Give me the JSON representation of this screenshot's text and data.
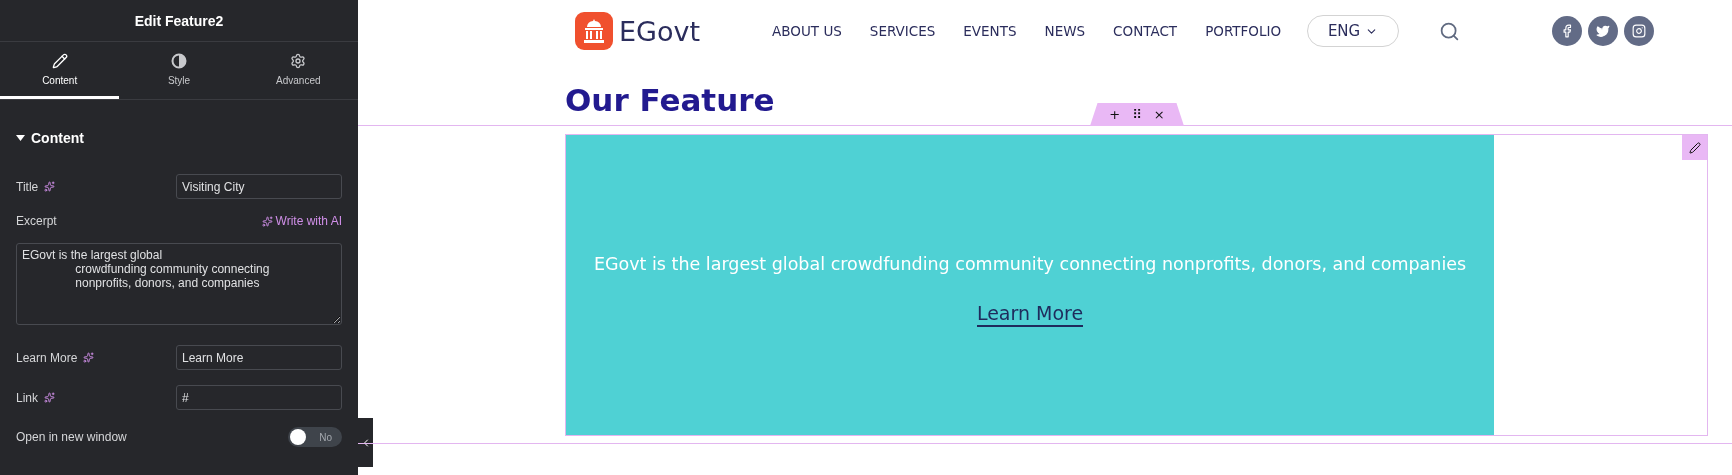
{
  "panel": {
    "title": "Edit Feature2",
    "tabs": [
      {
        "label": "Content",
        "selected": true
      },
      {
        "label": "Style",
        "selected": false
      },
      {
        "label": "Advanced",
        "selected": false
      }
    ],
    "section": {
      "title": "Content",
      "expanded": true
    },
    "fields": [
      {
        "kind": "input",
        "label": "Title",
        "ai": true,
        "value": "Visiting City"
      },
      {
        "kind": "textarea",
        "label": "Excerpt",
        "action": "Write with AI",
        "value": "EGovt is the largest global\n                crowdfunding community connecting\n                nonprofits, donors, and companies"
      },
      {
        "kind": "input",
        "label": "Learn More",
        "ai": true,
        "value": "Learn More"
      },
      {
        "kind": "input",
        "label": "Link",
        "ai": true,
        "value": "#"
      },
      {
        "kind": "toggle",
        "label": "Open in new window",
        "on": false,
        "state_label": "No"
      }
    ]
  },
  "site": {
    "logo": "EGovt",
    "nav": [
      "ABOUT US",
      "SERVICES",
      "EVENTS",
      "NEWS",
      "CONTACT",
      "PORTFOLIO"
    ],
    "language": "ENG",
    "heading": "Our Feature",
    "toolbar": [
      "+",
      "⠿",
      "×"
    ],
    "feature": {
      "text": "EGovt is the largest global crowdfunding community connecting nonprofits, donors, and companies",
      "link": "Learn More"
    }
  }
}
